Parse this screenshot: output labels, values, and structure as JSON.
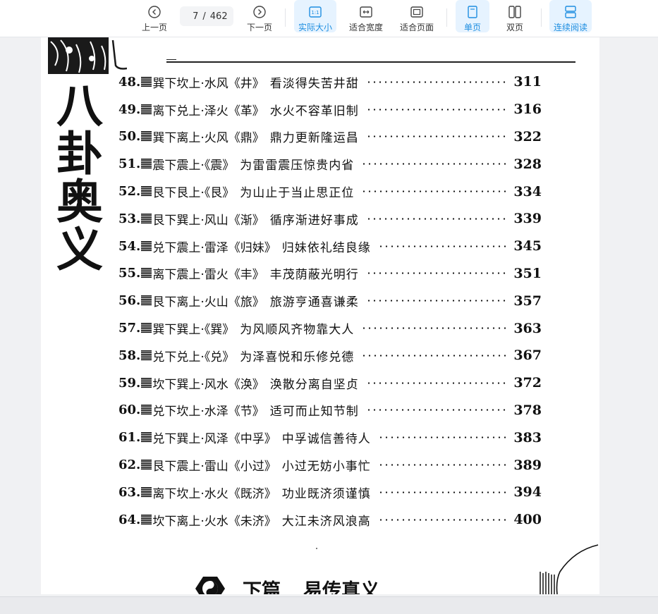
{
  "toolbar": {
    "prev_label": "上一页",
    "next_label": "下一页",
    "current_page": "7",
    "page_sep": "/",
    "total_pages": "462",
    "actual_size_label": "实际大小",
    "fit_width_label": "适合宽度",
    "fit_page_label": "适合页面",
    "single_page_label": "单页",
    "double_page_label": "双页",
    "continuous_label": "连续阅读",
    "accent_color": "#1e8ee0"
  },
  "document": {
    "side_title": "八卦奥义",
    "toc": [
      {
        "num": "48.",
        "title": "巽下坎上·水风《井》",
        "sub": "看淡得失苦井甜",
        "page": "311"
      },
      {
        "num": "49.",
        "title": "离下兑上·泽火《革》",
        "sub": "水火不容革旧制",
        "page": "316"
      },
      {
        "num": "50.",
        "title": "巽下离上·火风《鼎》",
        "sub": "鼎力更新隆运昌",
        "page": "322"
      },
      {
        "num": "51.",
        "title": "震下震上·《震》",
        "sub": "为雷雷震压惊贵内省",
        "page": "328"
      },
      {
        "num": "52.",
        "title": "艮下艮上·《艮》",
        "sub": "为山止于当止思正位",
        "page": "334"
      },
      {
        "num": "53.",
        "title": "艮下巽上·风山《渐》",
        "sub": "循序渐进好事成",
        "page": "339"
      },
      {
        "num": "54.",
        "title": "兑下震上·雷泽《归妹》",
        "sub": "归妹依礼结良缘",
        "page": "345"
      },
      {
        "num": "55.",
        "title": "离下震上·雷火《丰》",
        "sub": "丰茂荫蔽光明行",
        "page": "351"
      },
      {
        "num": "56.",
        "title": "艮下离上·火山《旅》",
        "sub": "旅游亨通喜谦柔",
        "page": "357"
      },
      {
        "num": "57.",
        "title": "巽下巽上·《巽》",
        "sub": "为风顺风齐物靠大人",
        "page": "363"
      },
      {
        "num": "58.",
        "title": "兑下兑上·《兑》",
        "sub": "为泽喜悦和乐修兑德",
        "page": "367"
      },
      {
        "num": "59.",
        "title": "坎下巽上·风水《涣》",
        "sub": "涣散分离自坚贞",
        "page": "372"
      },
      {
        "num": "60.",
        "title": "兑下坎上·水泽《节》",
        "sub": "适可而止知节制",
        "page": "378"
      },
      {
        "num": "61.",
        "title": "兑下巽上·风泽《中孚》",
        "sub": "中孚诚信善待人",
        "page": "383"
      },
      {
        "num": "62.",
        "title": "艮下震上·雷山《小过》",
        "sub": "小过无妨小事忙",
        "page": "389"
      },
      {
        "num": "63.",
        "title": "离下坎上·水火《既济》",
        "sub": "功业既济须谨慎",
        "page": "394"
      },
      {
        "num": "64.",
        "title": "坎下离上·火水《未济》",
        "sub": "大江未济风浪高",
        "page": "400"
      }
    ],
    "section_label": "下篇",
    "section_title": "易传真义"
  }
}
